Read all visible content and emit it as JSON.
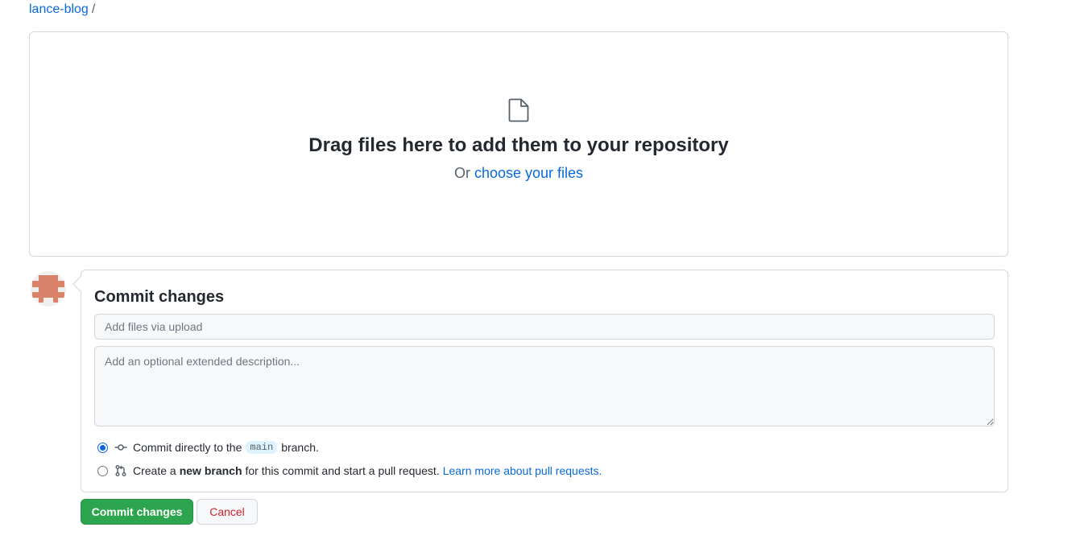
{
  "breadcrumb": {
    "repo": "lance-blog",
    "separator": "/"
  },
  "dropzone": {
    "icon": "file-icon",
    "title": "Drag files here to add them to your repository",
    "or_text": "Or",
    "choose_link": "choose your files"
  },
  "commit": {
    "heading": "Commit changes",
    "summary_placeholder": "Add files via upload",
    "description_placeholder": "Add an optional extended description...",
    "option_direct": {
      "prefix": "Commit directly to the",
      "branch": "main",
      "suffix": "branch.",
      "checked": true,
      "icon": "git-commit-icon"
    },
    "option_new_branch": {
      "prefix": "Create a",
      "bold": "new branch",
      "suffix": "for this commit and start a pull request.",
      "link": "Learn more about pull requests.",
      "checked": false,
      "icon": "git-pull-request-icon"
    },
    "submit_label": "Commit changes",
    "cancel_label": "Cancel"
  },
  "colors": {
    "link": "#0969da",
    "primary_button": "#2da44e",
    "cancel_text": "#cf222e",
    "border": "#d0d7de",
    "input_bg": "#f6f8fa"
  }
}
